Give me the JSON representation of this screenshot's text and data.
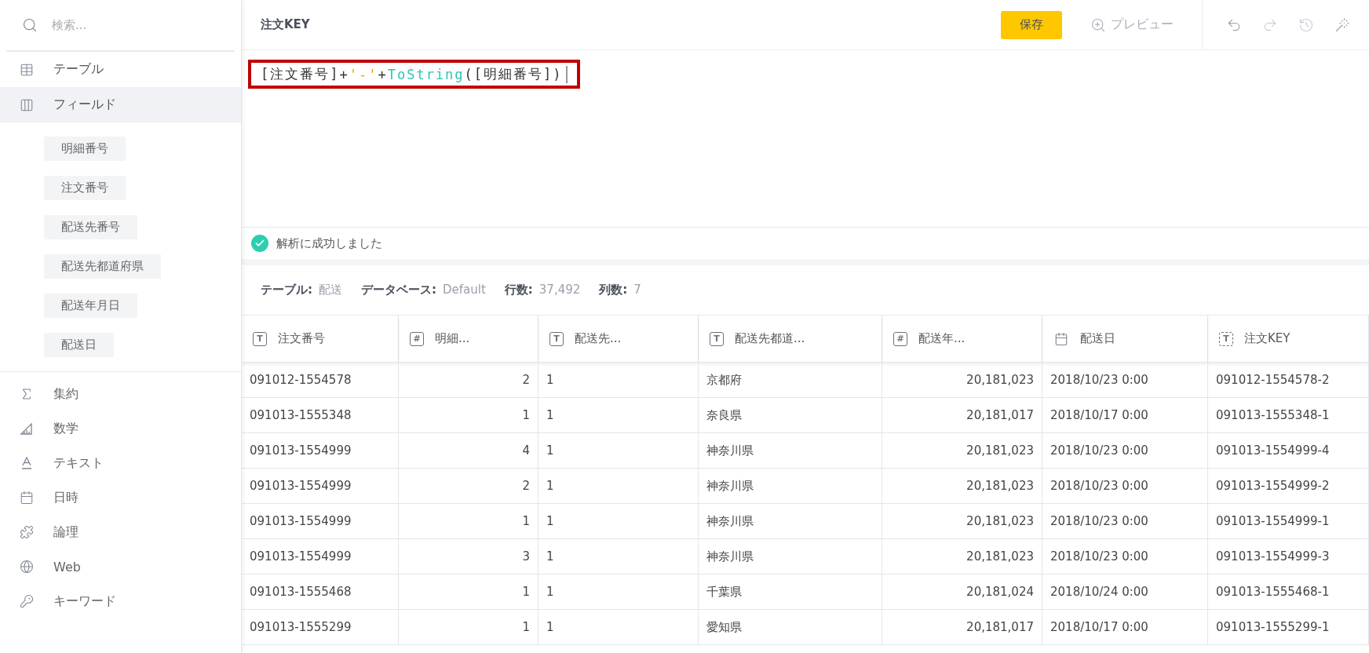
{
  "sidebar": {
    "search": {
      "placeholder": "検索..."
    },
    "nav": [
      {
        "label": "テーブル",
        "selected": false
      },
      {
        "label": "フィールド",
        "selected": true
      }
    ],
    "fields": [
      "明細番号",
      "注文番号",
      "配送先番号",
      "配送先都道府県",
      "配送年月日",
      "配送日"
    ],
    "categories": [
      "集約",
      "数学",
      "テキスト",
      "日時",
      "論理",
      "Web",
      "キーワード"
    ]
  },
  "editor": {
    "title": "注文KEY",
    "save": "保存",
    "preview": "プレビュー",
    "formula": {
      "highlighted": true,
      "tokens": [
        {
          "text": "[注文番号]",
          "kind": "field"
        },
        {
          "text": "+",
          "kind": "op"
        },
        {
          "text": "'-'",
          "kind": "string"
        },
        {
          "text": "+",
          "kind": "op"
        },
        {
          "text": "ToString",
          "kind": "function"
        },
        {
          "text": "(",
          "kind": "op"
        },
        {
          "text": "[明細番号]",
          "kind": "field"
        },
        {
          "text": ")",
          "kind": "op"
        }
      ]
    },
    "status": {
      "ok": true,
      "message": "解析に成功しました"
    }
  },
  "stats": [
    {
      "label": "テーブル:",
      "value": "配送"
    },
    {
      "label": "データベース:",
      "value": "Default"
    },
    {
      "label": "行数:",
      "value": "37,492"
    },
    {
      "label": "列数:",
      "value": "7"
    }
  ],
  "table": {
    "columns": [
      {
        "label": "注文番号",
        "kind": "text",
        "symbol": "T"
      },
      {
        "label": "明細...",
        "kind": "number",
        "symbol": "#"
      },
      {
        "label": "配送先...",
        "kind": "text",
        "symbol": "T"
      },
      {
        "label": "配送先都道...",
        "kind": "text",
        "symbol": "T"
      },
      {
        "label": "配送年...",
        "kind": "number",
        "symbol": "#"
      },
      {
        "label": "配送日",
        "kind": "date"
      },
      {
        "label": "注文KEY",
        "kind": "formula",
        "symbol": "T"
      }
    ],
    "rows": [
      [
        "091012-1554578",
        "2",
        "1",
        "京都府",
        "20,181,023",
        "2018/10/23 0:00",
        "091012-1554578-2"
      ],
      [
        "091013-1555348",
        "1",
        "1",
        "奈良県",
        "20,181,017",
        "2018/10/17 0:00",
        "091013-1555348-1"
      ],
      [
        "091013-1554999",
        "4",
        "1",
        "神奈川県",
        "20,181,023",
        "2018/10/23 0:00",
        "091013-1554999-4"
      ],
      [
        "091013-1554999",
        "2",
        "1",
        "神奈川県",
        "20,181,023",
        "2018/10/23 0:00",
        "091013-1554999-2"
      ],
      [
        "091013-1554999",
        "1",
        "1",
        "神奈川県",
        "20,181,023",
        "2018/10/23 0:00",
        "091013-1554999-1"
      ],
      [
        "091013-1554999",
        "3",
        "1",
        "神奈川県",
        "20,181,023",
        "2018/10/23 0:00",
        "091013-1554999-3"
      ],
      [
        "091013-1555468",
        "1",
        "1",
        "千葉県",
        "20,181,024",
        "2018/10/24 0:00",
        "091013-1555468-1"
      ],
      [
        "091013-1555299",
        "1",
        "1",
        "愛知県",
        "20,181,017",
        "2018/10/17 0:00",
        "091013-1555299-1"
      ]
    ]
  }
}
